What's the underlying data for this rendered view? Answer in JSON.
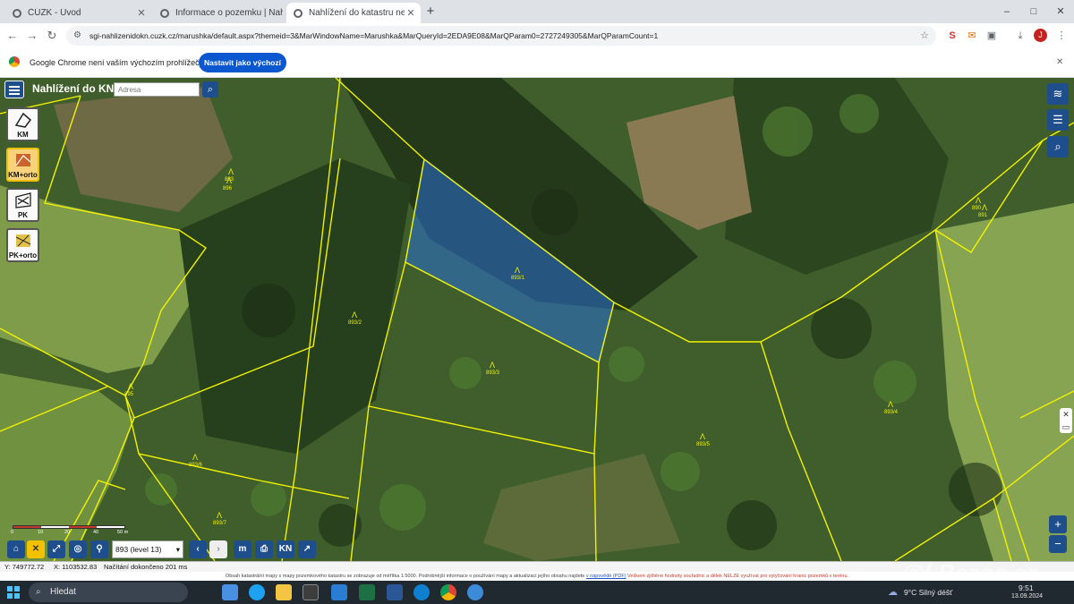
{
  "tabs": [
    {
      "title": "ČÚZK - Úvod"
    },
    {
      "title": "Informace o pozemku | Nahlížení"
    },
    {
      "title": "Nahlížení do katastru nemovitostí"
    }
  ],
  "window_controls": {
    "minimize": "–",
    "maximize": "□",
    "close": "✕"
  },
  "url": "sgi-nahlizenidokn.cuzk.cz/marushka/default.aspx?themeid=3&MarWindowName=Marushka&MarQueryId=2EDA9E08&MarQParam0=2727249305&MarQParamCount=1",
  "profile_initial": "J",
  "infobar": {
    "message": "Google Chrome není vaším výchozím prohlížečem",
    "button": "Nastavit jako výchozí",
    "close": "✕"
  },
  "app": {
    "title": "Nahlížení do KN",
    "address_placeholder": "Adresa"
  },
  "layers": [
    {
      "label": "KM"
    },
    {
      "label": "KM+orto"
    },
    {
      "label": "PK"
    },
    {
      "label": "PK+orto"
    }
  ],
  "scale_bar": {
    "labels": [
      "0",
      "10",
      "20",
      "40",
      "50 m"
    ]
  },
  "scale_select": "893 (level 13)",
  "parcel_labels": [
    "893",
    "893/1",
    "893/2",
    "893/3",
    "893/4",
    "893/5",
    "893/6",
    "893/7",
    "891",
    "895",
    "896",
    "890"
  ],
  "status": {
    "y": "Y: 749772.72",
    "x": "X: 1103532.83",
    "load": "Načítání dokončeno 201 ms"
  },
  "notice": {
    "left": "Obsah katastrální mapy s mapy pozemkového katastru se zobrazuje od měřítka 1:5000. Podrobnější informace o používání mapy a aktualizaci jejího obsahu najdete",
    "link": "v nápovědě (PDF)",
    "right": "Veškeré zjištěné hodnoty souřadnic a délek NELZE využívat pro vytyčování hranic pozemků v terénu."
  },
  "watermark": "@( Bazos.cz",
  "taskbar": {
    "search": "Hledat",
    "weather": "9°C Silný déšť",
    "time": "9:51",
    "date": "13.09.2024"
  },
  "colors": {
    "parcel_lines": "#f2f200",
    "selected_parcel": "#2a6fd6",
    "app_blue": "#1f4e8c",
    "chrome_button": "#0b57d0"
  }
}
